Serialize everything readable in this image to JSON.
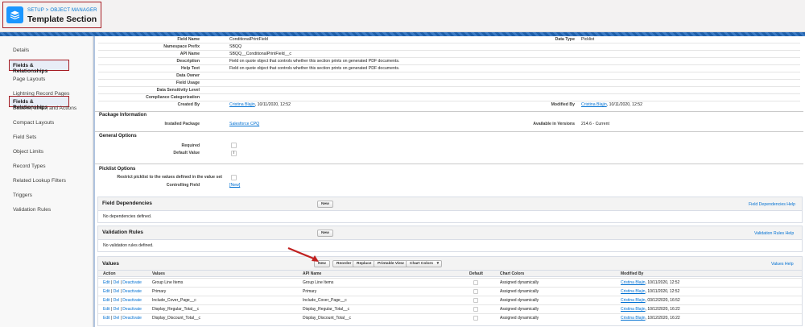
{
  "header": {
    "breadcrumb": "SETUP > OBJECT MANAGER",
    "title": "Template Section"
  },
  "sidebar": {
    "items": [
      {
        "label": "Details"
      },
      {
        "label": "Fields & Relationships",
        "active": true
      },
      {
        "label": "Page Layouts"
      },
      {
        "label": "Lightning Record Pages"
      },
      {
        "label": "Buttons, Links, and Actions"
      },
      {
        "label": "Compact Layouts"
      },
      {
        "label": "Field Sets"
      },
      {
        "label": "Object Limits"
      },
      {
        "label": "Record Types"
      },
      {
        "label": "Related Lookup Filters"
      },
      {
        "label": "Triggers"
      },
      {
        "label": "Validation Rules"
      }
    ]
  },
  "field_info": {
    "rows": [
      {
        "label": "Field Name",
        "value": "ConditionalPrintField"
      },
      {
        "label": "Namespace Prefix",
        "value": "SBQQ"
      },
      {
        "label": "API Name",
        "value": "SBQQ__ConditionalPrintField__c"
      },
      {
        "label": "Description",
        "value": "Field on quote object that controls whether this section prints on generated PDF documents."
      },
      {
        "label": "Help Text",
        "value": "Field on quote object that controls whether this section prints on generated PDF documents."
      },
      {
        "label": "Data Owner",
        "value": ""
      },
      {
        "label": "Field Usage",
        "value": ""
      },
      {
        "label": "Data Sensitivity Level",
        "value": ""
      },
      {
        "label": "Compliance Categorization",
        "value": ""
      }
    ],
    "created_by_label": "Created By",
    "created_by_name": "Cristina Blajin",
    "created_by_date": ", 10/11/2020, 12:52",
    "data_type_label": "Data Type",
    "data_type_value": "Picklist",
    "modified_by_label": "Modified By",
    "modified_by_name": "Cristina Blajin",
    "modified_by_date": ", 10/11/2020, 12:52"
  },
  "package_info": {
    "title": "Package Information",
    "installed_label": "Installed Package",
    "installed_value": "Salesforce CPQ",
    "versions_label": "Available in Versions",
    "versions_value": "214.6 - Current"
  },
  "general_options": {
    "title": "General Options",
    "required_label": "Required",
    "default_label": "Default Value"
  },
  "picklist_options": {
    "title": "Picklist Options",
    "restrict_label": "Restrict picklist to the values defined in the value set",
    "controlling_label": "Controlling Field",
    "controlling_value": "[New]"
  },
  "field_dependencies": {
    "title": "Field Dependencies",
    "new_label": "New",
    "help": "Field Dependencies Help",
    "empty": "No dependencies defined."
  },
  "validation_rules": {
    "title": "Validation Rules",
    "new_label": "New",
    "help": "Validation Rules Help",
    "empty": "No validation rules defined."
  },
  "values": {
    "title": "Values",
    "buttons": {
      "new": "New",
      "reorder": "Reorder",
      "replace": "Replace",
      "printable": "Printable View",
      "chart_colors": "Chart Colors"
    },
    "help": "Values Help",
    "columns": {
      "action": "Action",
      "values": "Values",
      "api_name": "API Name",
      "default": "Default",
      "chart_colors": "Chart Colors",
      "modified_by": "Modified By"
    },
    "rows": [
      {
        "edit": "Edit",
        "del": "Del",
        "deactivate": "Deactivate",
        "value": "Group Line Items",
        "api": "Group Line Items",
        "color": "Assigned dynamically",
        "by": "Cristina Blajin",
        "date": ", 10/11/2020, 12:52"
      },
      {
        "edit": "Edit",
        "del": "Del",
        "deactivate": "Deactivate",
        "value": "Primary",
        "api": "Primary",
        "color": "Assigned dynamically",
        "by": "Cristina Blajin",
        "date": ", 10/11/2020, 12:52"
      },
      {
        "edit": "Edit",
        "del": "Del",
        "deactivate": "Deactivate",
        "value": "Include_Cover_Page__c",
        "api": "Include_Cover_Page__c",
        "color": "Assigned dynamically",
        "by": "Cristina Blajin",
        "date": ", 03/12/2020, 16:52"
      },
      {
        "edit": "Edit",
        "del": "Del",
        "deactivate": "Deactivate",
        "value": "Display_Regular_Total__c",
        "api": "Display_Regular_Total__c",
        "color": "Assigned dynamically",
        "by": "Cristina Blajin",
        "date": ", 10/12/2020, 16:22"
      },
      {
        "edit": "Edit",
        "del": "Del",
        "deactivate": "Deactivate",
        "value": "Display_Discount_Total__c",
        "api": "Display_Discount_Total__c",
        "color": "Assigned dynamically",
        "by": "Cristina Blajin",
        "date": ", 10/12/2020, 16:22"
      }
    ]
  },
  "colors": {
    "link": "#0070d2",
    "highlight": "#a61d24",
    "brand": "#1b96ff"
  },
  "icons": {
    "app": "layers-icon",
    "dropdown": "chevron-down-icon",
    "lookup": "lookup-icon",
    "annotation": "arrow-icon"
  }
}
